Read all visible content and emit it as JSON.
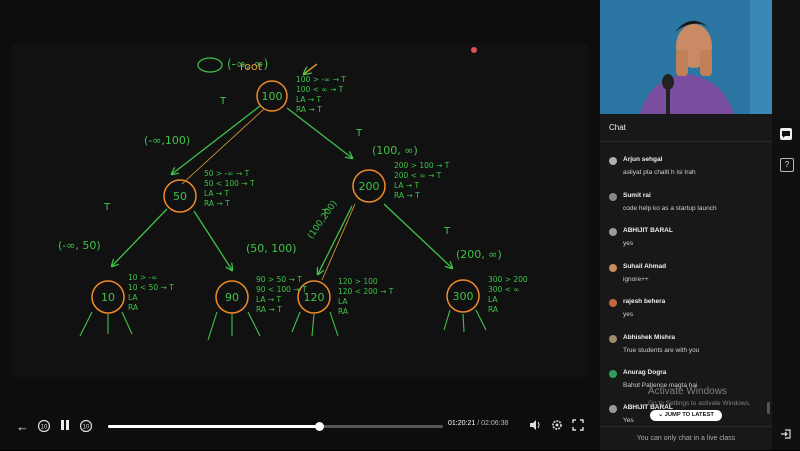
{
  "board": {
    "root_label": "root",
    "annotations": [
      "(-∞, ∞)",
      "(-∞,100)",
      "(100, ∞)",
      "(-∞, 50)",
      "(50, 100)",
      "(100,200)",
      "(200, ∞)",
      "T",
      "T",
      "T",
      "T",
      "T"
    ],
    "nodes": [
      "100",
      "50",
      "200",
      "10",
      "90",
      "120",
      "300"
    ],
    "node_checks": {
      "100": [
        "100 > -∞ → T",
        "100 < ∞ → T",
        "LA → T",
        "RA → T"
      ],
      "50": [
        "50 > -∞ → T",
        "50 < 100 → T",
        "LA → T",
        "RA → T"
      ],
      "200": [
        "200 > 100 → T",
        "200 < ∞ → T",
        "LA → T",
        "RA → T"
      ],
      "10": [
        "10 > -∞",
        "10 < 50 → T",
        "LA",
        "RA"
      ],
      "90": [
        "90 > 50 → T",
        "90 < 100 → T",
        "LA → T",
        "RA → T"
      ],
      "120": [
        "120 > 100",
        "120 < 200 → T",
        "LA",
        "RA"
      ],
      "300": [
        "300 > 200",
        "300 < ∞",
        "LA",
        "RA"
      ]
    },
    "colors": {
      "ink": "#3fc24a",
      "node": "#f08a2a",
      "note": "#e8a23c"
    }
  },
  "player": {
    "back_icon": "arrow-left",
    "rewind_label": "10",
    "forward_label": "10",
    "progress": 0.631,
    "current_time": "01:20:21",
    "separator": "/",
    "duration": "02:06:38",
    "icons": [
      "volume-icon",
      "settings-gear-icon",
      "fullscreen-icon"
    ]
  },
  "chat": {
    "title": "Chat",
    "messages": [
      {
        "name": "Arjun sehgal",
        "text": "asliyat pta chalti h isi trah",
        "avatar_color": "#b0b0b0"
      },
      {
        "name": "Sumit rai",
        "text": "code help ko as a startup launch",
        "avatar_color": "#888888"
      },
      {
        "name": "ABHIJIT BARAL",
        "text": "yes",
        "avatar_color": "#9c9c9c"
      },
      {
        "name": "Suhail Ahmad",
        "text": "ignore++",
        "avatar_color": "#c98c5a"
      },
      {
        "name": "rajesh behera",
        "text": "yes",
        "avatar_color": "#c46a3a"
      },
      {
        "name": "Abhishek Mishra",
        "text": "True students are with you",
        "avatar_color": "#a08a6a"
      },
      {
        "name": "Anurag Dogra",
        "text": "Bahot Patience magta hai",
        "avatar_color": "#2e9e5a"
      },
      {
        "name": "ABHIJIT BARAL",
        "text": "Yes",
        "avatar_color": "#9c9c9c"
      }
    ],
    "jump_label": "⌄ JUMP TO LATEST",
    "footer": "You can only chat in a live class",
    "watermark_title": "Activate Windows",
    "watermark_sub": "Go to Settings to activate Windows."
  },
  "rail": {
    "chat_icon": "chat-bubble-icon",
    "help_icon": "question-icon",
    "exit_icon": "exit-icon",
    "help_label": "?"
  }
}
